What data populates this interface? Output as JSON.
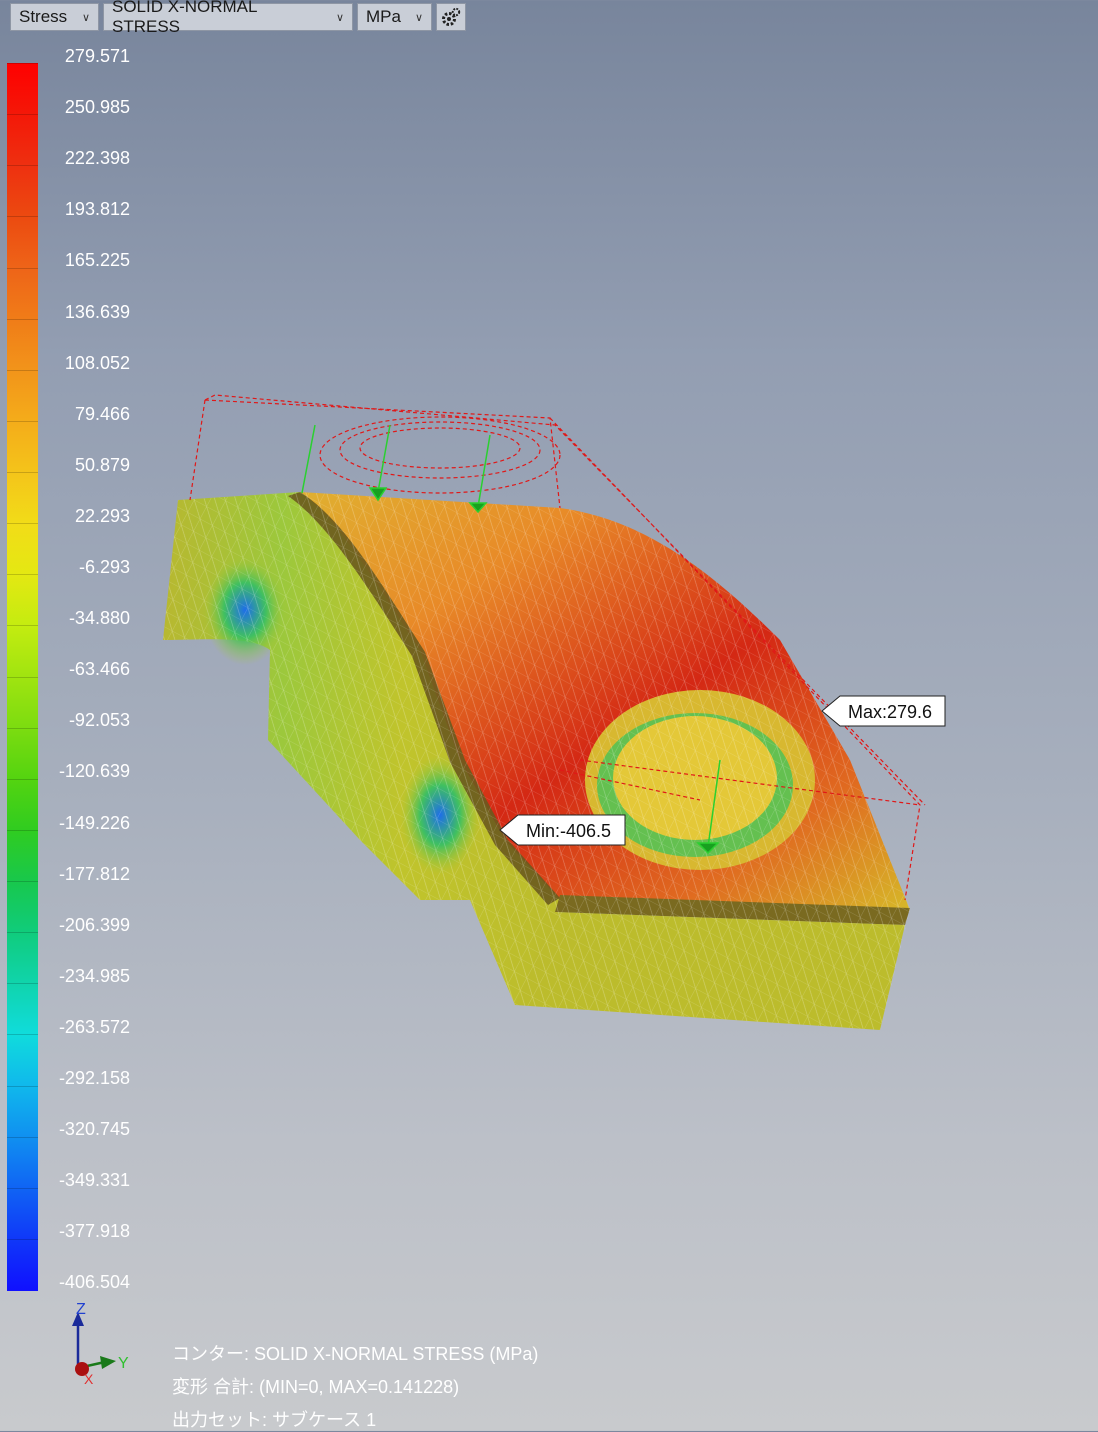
{
  "toolbar": {
    "result_type": "Stress",
    "component": "SOLID X-NORMAL STRESS",
    "unit": "MPa",
    "settings_icon": "gear-settings-icon"
  },
  "legend": {
    "labels": [
      "279.571",
      "250.985",
      "222.398",
      "193.812",
      "165.225",
      "136.639",
      "108.052",
      "79.466",
      "50.879",
      "22.293",
      "-6.293",
      "-34.880",
      "-63.466",
      "-92.053",
      "-120.639",
      "-149.226",
      "-177.812",
      "-206.399",
      "-234.985",
      "-263.572",
      "-292.158",
      "-320.745",
      "-349.331",
      "-377.918",
      "-406.504"
    ],
    "colors": [
      "#ff0000",
      "#f41808",
      "#ee3010",
      "#ec4a10",
      "#ee6418",
      "#f07c18",
      "#f2941a",
      "#f4ac1a",
      "#f4c41a",
      "#f2dc18",
      "#e4e812",
      "#c4ec10",
      "#a0e410",
      "#7cdc10",
      "#54d410",
      "#30cc20",
      "#18c84c",
      "#10cc7c",
      "#10d4ac",
      "#10dcdc",
      "#10b8ec",
      "#1090f0",
      "#1064f4",
      "#1038f8",
      "#1010ff"
    ]
  },
  "callouts": {
    "max": "Max:279.6",
    "min": "Min:-406.5"
  },
  "triad": {
    "z": "Z",
    "y": "Y",
    "x": "X"
  },
  "info": {
    "contour": "コンター: SOLID X-NORMAL STRESS (MPa)",
    "deform": "変形 合計: (MIN=0, MAX=0.141228)",
    "output_set": "出力セット: サブケース 1"
  }
}
